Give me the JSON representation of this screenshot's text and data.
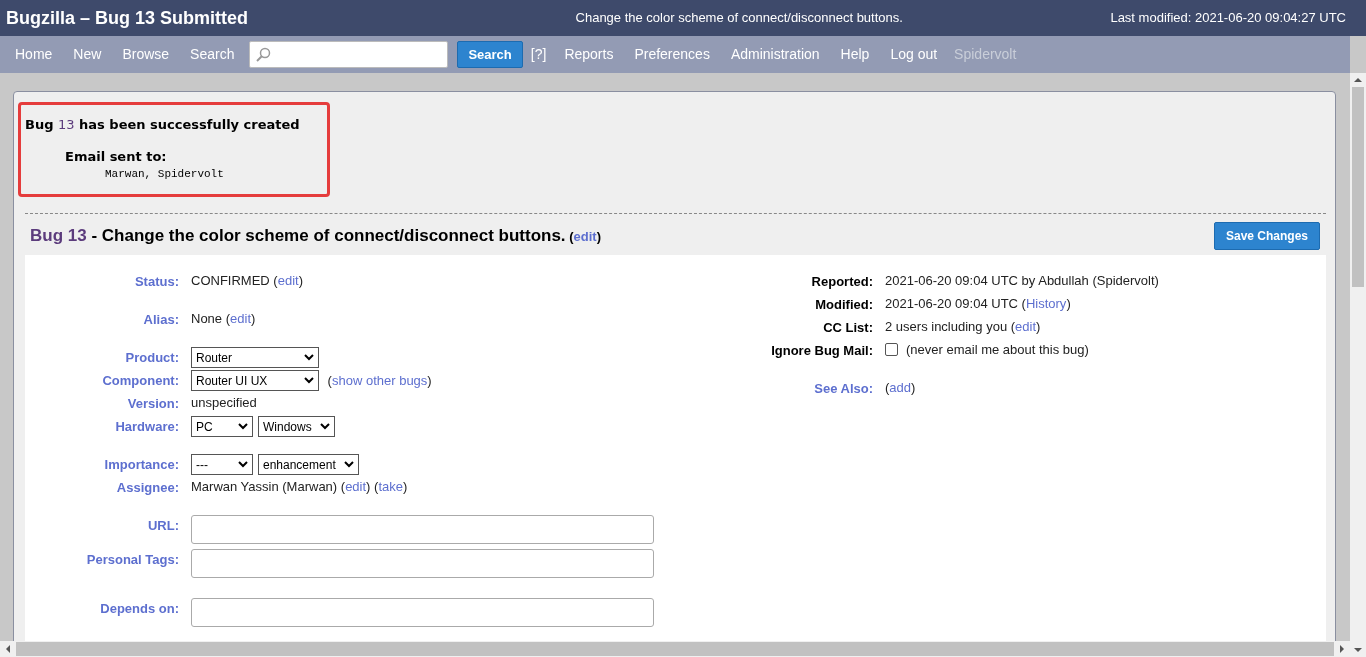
{
  "header": {
    "title": "Bugzilla – Bug 13 Submitted",
    "summary": "Change the color scheme of connect/disconnect buttons.",
    "last_modified": "Last modified: 2021-06-20 09:04:27 UTC"
  },
  "nav": [
    {
      "kind": "link",
      "text": "Home"
    },
    {
      "kind": "link",
      "text": "New"
    },
    {
      "kind": "link",
      "text": "Browse"
    },
    {
      "kind": "link",
      "text": "Search"
    },
    {
      "kind": "search_field"
    },
    {
      "kind": "button",
      "text": "Search"
    },
    {
      "kind": "help",
      "text": "[?]"
    },
    {
      "kind": "link",
      "text": "Reports"
    },
    {
      "kind": "link",
      "text": "Preferences"
    },
    {
      "kind": "link",
      "text": "Administration"
    },
    {
      "kind": "link",
      "text": "Help"
    },
    {
      "kind": "link",
      "text": "Log out"
    },
    {
      "kind": "user",
      "text": "Spidervolt"
    }
  ],
  "message": {
    "parts": [
      {
        "text": "Bug ",
        "link": false
      },
      {
        "text": "13",
        "link": true
      },
      {
        "text": " has been successfully created",
        "link": false
      }
    ],
    "email_label": "Email sent to:",
    "recipients": "Marwan, Spidervolt"
  },
  "bug_title": {
    "id": "Bug 13",
    "summary": " - Change the color scheme of connect/disconnect buttons.",
    "edit_parts": [
      {
        "text": " (",
        "link": false
      },
      {
        "text": "edit",
        "link": true
      },
      {
        "text": ")",
        "link": false
      }
    ]
  },
  "save_button": "Save Changes",
  "left_sections": [
    [
      {
        "label": "Status:",
        "label_link": true,
        "kind": "text",
        "parts": [
          {
            "text": "CONFIRMED (",
            "link": false
          },
          {
            "text": "edit",
            "link": true
          },
          {
            "text": ")",
            "link": false
          }
        ]
      }
    ],
    [
      {
        "label": "Alias:",
        "label_link": true,
        "kind": "text",
        "parts": [
          {
            "text": "None (",
            "link": false
          },
          {
            "text": "edit",
            "link": true
          },
          {
            "text": ")",
            "link": false
          }
        ]
      }
    ],
    [
      {
        "label": "Product:",
        "label_link": true,
        "kind": "selects",
        "selects": [
          {
            "value": "Router"
          }
        ]
      },
      {
        "label": "Component:",
        "label_link": true,
        "kind": "selects",
        "selects": [
          {
            "value": "Router UI UX"
          }
        ],
        "parts": [
          {
            "text": " (",
            "link": false
          },
          {
            "text": "show other bugs",
            "link": true
          },
          {
            "text": ")",
            "link": false
          }
        ]
      },
      {
        "label": "Version:",
        "label_link": true,
        "kind": "text",
        "parts": [
          {
            "text": "unspecified",
            "link": false
          }
        ]
      },
      {
        "label": "Hardware:",
        "label_link": true,
        "kind": "selects",
        "selects": [
          {
            "value": "PC"
          },
          {
            "value": "Windows"
          }
        ]
      }
    ],
    [
      {
        "label": "Importance:",
        "label_link": true,
        "kind": "selects",
        "selects": [
          {
            "value": "---"
          },
          {
            "value": "enhancement"
          }
        ]
      },
      {
        "label": "Assignee:",
        "label_link": true,
        "kind": "text",
        "parts": [
          {
            "text": "Marwan Yassin (Marwan) (",
            "link": false
          },
          {
            "text": "edit",
            "link": true
          },
          {
            "text": ") (",
            "link": false
          },
          {
            "text": "take",
            "link": true
          },
          {
            "text": ")",
            "link": false
          }
        ]
      }
    ],
    [
      {
        "label": "URL:",
        "label_link": true,
        "kind": "input"
      },
      {
        "label": "Personal Tags:",
        "label_link": true,
        "kind": "input"
      }
    ],
    [
      {
        "label": "Depends on:",
        "label_link": true,
        "kind": "input"
      }
    ]
  ],
  "right_sections": [
    [
      {
        "label": "Reported:",
        "label_link": false,
        "kind": "text",
        "parts": [
          {
            "text": "2021-06-20 09:04 UTC by Abdullah (Spidervolt)",
            "link": false
          }
        ]
      },
      {
        "label": "Modified:",
        "label_link": false,
        "kind": "text",
        "parts": [
          {
            "text": "2021-06-20 09:04 UTC (",
            "link": false
          },
          {
            "text": "History",
            "link": true
          },
          {
            "text": ")",
            "link": false
          }
        ]
      },
      {
        "label": "CC List:",
        "label_link": false,
        "kind": "text",
        "parts": [
          {
            "text": "2 users including you (",
            "link": false
          },
          {
            "text": "edit",
            "link": true
          },
          {
            "text": ")",
            "link": false
          }
        ]
      },
      {
        "label": "Ignore Bug Mail:",
        "label_link": false,
        "kind": "checkbox",
        "checked": false,
        "parts": [
          {
            "text": "(never email me about this bug)",
            "link": false
          }
        ]
      }
    ],
    [
      {
        "label": "See Also:",
        "label_link": true,
        "kind": "text",
        "parts": [
          {
            "text": "(",
            "link": false
          },
          {
            "text": "add",
            "link": true
          },
          {
            "text": ")",
            "link": false
          }
        ]
      }
    ]
  ]
}
